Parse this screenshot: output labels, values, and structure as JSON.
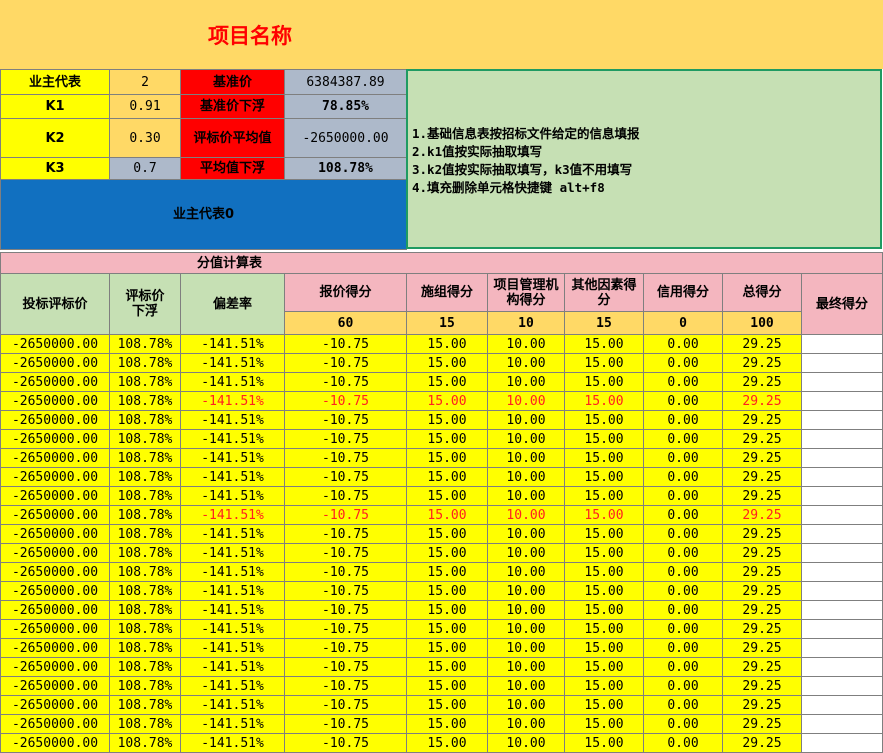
{
  "title": "项目名称",
  "params": {
    "owner_label": "业主代表",
    "owner_value": "2",
    "k1_label": "K1",
    "k1_value": "0.91",
    "k2_label": "K2",
    "k2_value": "0.30",
    "k3_label": "K3",
    "k3_value": "0.7",
    "base_price_label": "基准价",
    "base_price_value": "6384387.89",
    "base_down_label": "基准价下浮",
    "base_down_value": "78.85%",
    "avg_price_label": "评标价平均值",
    "avg_price_value": "-2650000.00",
    "avg_down_label": "平均值下浮",
    "avg_down_value": "108.78%",
    "owner_block": "业主代表0"
  },
  "notes": [
    "1.基础信息表按招标文件给定的信息填报",
    "2.k1值按实际抽取填写",
    "3.k2值按实际抽取填写，k3值不用填写",
    "4.填充删除单元格快捷键 alt+f8"
  ],
  "table": {
    "section_title": "分值计算表",
    "headers": {
      "bid_price": "投标评标价",
      "bid_down": "评标价下浮",
      "deviation": "偏差率",
      "price_score": "报价得分",
      "construction_score": "施组得分",
      "management_score": "项目管理机构得分",
      "other_score": "其他因素得分",
      "credit_score": "信用得分",
      "total_score": "总得分",
      "final_score": "最终得分"
    },
    "weights": [
      "60",
      "15",
      "10",
      "15",
      "0",
      "100"
    ],
    "rows": [
      {
        "bid": "-2650000.00",
        "down": "108.78%",
        "dev": "-141.51%",
        "price": "-10.75",
        "cons": "15.00",
        "mgmt": "10.00",
        "other": "15.00",
        "credit": "0.00",
        "total": "29.25",
        "final": "",
        "highlight": false
      },
      {
        "bid": "-2650000.00",
        "down": "108.78%",
        "dev": "-141.51%",
        "price": "-10.75",
        "cons": "15.00",
        "mgmt": "10.00",
        "other": "15.00",
        "credit": "0.00",
        "total": "29.25",
        "final": "",
        "highlight": false
      },
      {
        "bid": "-2650000.00",
        "down": "108.78%",
        "dev": "-141.51%",
        "price": "-10.75",
        "cons": "15.00",
        "mgmt": "10.00",
        "other": "15.00",
        "credit": "0.00",
        "total": "29.25",
        "final": "",
        "highlight": false
      },
      {
        "bid": "-2650000.00",
        "down": "108.78%",
        "dev": "-141.51%",
        "price": "-10.75",
        "cons": "15.00",
        "mgmt": "10.00",
        "other": "15.00",
        "credit": "0.00",
        "total": "29.25",
        "final": "",
        "highlight": true
      },
      {
        "bid": "-2650000.00",
        "down": "108.78%",
        "dev": "-141.51%",
        "price": "-10.75",
        "cons": "15.00",
        "mgmt": "10.00",
        "other": "15.00",
        "credit": "0.00",
        "total": "29.25",
        "final": "",
        "highlight": false
      },
      {
        "bid": "-2650000.00",
        "down": "108.78%",
        "dev": "-141.51%",
        "price": "-10.75",
        "cons": "15.00",
        "mgmt": "10.00",
        "other": "15.00",
        "credit": "0.00",
        "total": "29.25",
        "final": "",
        "highlight": false
      },
      {
        "bid": "-2650000.00",
        "down": "108.78%",
        "dev": "-141.51%",
        "price": "-10.75",
        "cons": "15.00",
        "mgmt": "10.00",
        "other": "15.00",
        "credit": "0.00",
        "total": "29.25",
        "final": "",
        "highlight": false
      },
      {
        "bid": "-2650000.00",
        "down": "108.78%",
        "dev": "-141.51%",
        "price": "-10.75",
        "cons": "15.00",
        "mgmt": "10.00",
        "other": "15.00",
        "credit": "0.00",
        "total": "29.25",
        "final": "",
        "highlight": false
      },
      {
        "bid": "-2650000.00",
        "down": "108.78%",
        "dev": "-141.51%",
        "price": "-10.75",
        "cons": "15.00",
        "mgmt": "10.00",
        "other": "15.00",
        "credit": "0.00",
        "total": "29.25",
        "final": "",
        "highlight": false
      },
      {
        "bid": "-2650000.00",
        "down": "108.78%",
        "dev": "-141.51%",
        "price": "-10.75",
        "cons": "15.00",
        "mgmt": "10.00",
        "other": "15.00",
        "credit": "0.00",
        "total": "29.25",
        "final": "",
        "highlight": true
      },
      {
        "bid": "-2650000.00",
        "down": "108.78%",
        "dev": "-141.51%",
        "price": "-10.75",
        "cons": "15.00",
        "mgmt": "10.00",
        "other": "15.00",
        "credit": "0.00",
        "total": "29.25",
        "final": "",
        "highlight": false
      },
      {
        "bid": "-2650000.00",
        "down": "108.78%",
        "dev": "-141.51%",
        "price": "-10.75",
        "cons": "15.00",
        "mgmt": "10.00",
        "other": "15.00",
        "credit": "0.00",
        "total": "29.25",
        "final": "",
        "highlight": false
      },
      {
        "bid": "-2650000.00",
        "down": "108.78%",
        "dev": "-141.51%",
        "price": "-10.75",
        "cons": "15.00",
        "mgmt": "10.00",
        "other": "15.00",
        "credit": "0.00",
        "total": "29.25",
        "final": "",
        "highlight": false
      },
      {
        "bid": "-2650000.00",
        "down": "108.78%",
        "dev": "-141.51%",
        "price": "-10.75",
        "cons": "15.00",
        "mgmt": "10.00",
        "other": "15.00",
        "credit": "0.00",
        "total": "29.25",
        "final": "",
        "highlight": false
      },
      {
        "bid": "-2650000.00",
        "down": "108.78%",
        "dev": "-141.51%",
        "price": "-10.75",
        "cons": "15.00",
        "mgmt": "10.00",
        "other": "15.00",
        "credit": "0.00",
        "total": "29.25",
        "final": "",
        "highlight": false
      },
      {
        "bid": "-2650000.00",
        "down": "108.78%",
        "dev": "-141.51%",
        "price": "-10.75",
        "cons": "15.00",
        "mgmt": "10.00",
        "other": "15.00",
        "credit": "0.00",
        "total": "29.25",
        "final": "",
        "highlight": false
      },
      {
        "bid": "-2650000.00",
        "down": "108.78%",
        "dev": "-141.51%",
        "price": "-10.75",
        "cons": "15.00",
        "mgmt": "10.00",
        "other": "15.00",
        "credit": "0.00",
        "total": "29.25",
        "final": "",
        "highlight": false
      },
      {
        "bid": "-2650000.00",
        "down": "108.78%",
        "dev": "-141.51%",
        "price": "-10.75",
        "cons": "15.00",
        "mgmt": "10.00",
        "other": "15.00",
        "credit": "0.00",
        "total": "29.25",
        "final": "",
        "highlight": false
      },
      {
        "bid": "-2650000.00",
        "down": "108.78%",
        "dev": "-141.51%",
        "price": "-10.75",
        "cons": "15.00",
        "mgmt": "10.00",
        "other": "15.00",
        "credit": "0.00",
        "total": "29.25",
        "final": "",
        "highlight": false
      },
      {
        "bid": "-2650000.00",
        "down": "108.78%",
        "dev": "-141.51%",
        "price": "-10.75",
        "cons": "15.00",
        "mgmt": "10.00",
        "other": "15.00",
        "credit": "0.00",
        "total": "29.25",
        "final": "",
        "highlight": false
      },
      {
        "bid": "-2650000.00",
        "down": "108.78%",
        "dev": "-141.51%",
        "price": "-10.75",
        "cons": "15.00",
        "mgmt": "10.00",
        "other": "15.00",
        "credit": "0.00",
        "total": "29.25",
        "final": "",
        "highlight": false
      },
      {
        "bid": "-2650000.00",
        "down": "108.78%",
        "dev": "-141.51%",
        "price": "-10.75",
        "cons": "15.00",
        "mgmt": "10.00",
        "other": "15.00",
        "credit": "0.00",
        "total": "29.25",
        "final": "",
        "highlight": false
      }
    ]
  },
  "colors": {
    "title_band": "#ffd966",
    "title_text": "#ff0000",
    "yellow": "#ffff00",
    "red": "#ff0000",
    "grey": "#adb9ca",
    "pink": "#f4b6bf",
    "green": "#c6e0b4",
    "blue": "#1170c0",
    "highlight_text": "#ff2020"
  }
}
